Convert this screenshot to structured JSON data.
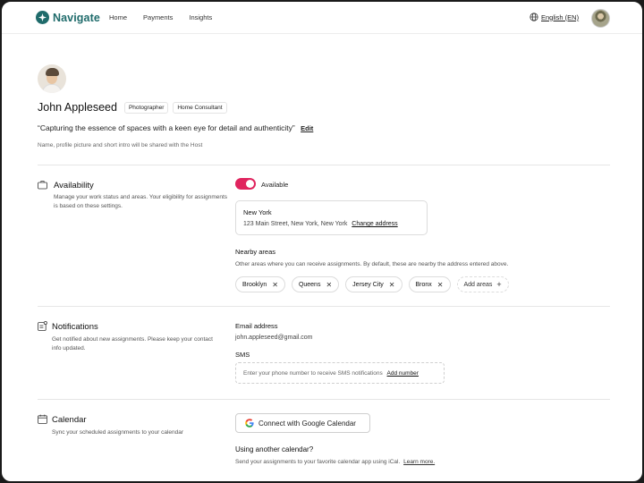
{
  "nav": {
    "brand": "Navigate",
    "links": [
      "Home",
      "Payments",
      "Insights"
    ],
    "language": "English (EN)"
  },
  "profile": {
    "name": "John Appleseed",
    "tags": [
      "Photographer",
      "Home Consultant"
    ],
    "quote": "“Capturing the essence of spaces with a keen eye for detail and authenticity”",
    "edit_label": "Edit",
    "shared_note": "Name, profile picture and short intro will be shared with the Host"
  },
  "availability": {
    "title": "Availability",
    "description": "Manage your work status and areas. Your eligibility for assignments is based on these settings.",
    "toggle_label": "Available",
    "toggle_on": true,
    "city": "New York",
    "address": "123 Main Street, New York, New York",
    "change_address_label": "Change address",
    "nearby_title": "Nearby areas",
    "nearby_description": "Other areas where you can receive assignments. By default, these are nearby the address entered above.",
    "areas": [
      "Brooklyn",
      "Queens",
      "Jersey City",
      "Bronx"
    ],
    "add_areas_label": "Add areas"
  },
  "notifications": {
    "title": "Notifications",
    "description": "Get notified about new assignments. Please keep your contact info updated.",
    "email_label": "Email address",
    "email_value": "john.appleseed@gmail.com",
    "sms_label": "SMS",
    "sms_placeholder": "Enter your phone number to receive SMS notifications",
    "add_number_label": "Add number"
  },
  "calendar": {
    "title": "Calendar",
    "description": "Sync your scheduled assignments to your calendar",
    "google_button_label": "Connect with Google Calendar",
    "other_title": "Using another calendar?",
    "other_description": "Send your assignments to your favorite calendar app using iCal.",
    "learn_more_label": "Learn more."
  },
  "colors": {
    "brand": "#1f6b6b",
    "toggle_on": "#e0245e"
  }
}
